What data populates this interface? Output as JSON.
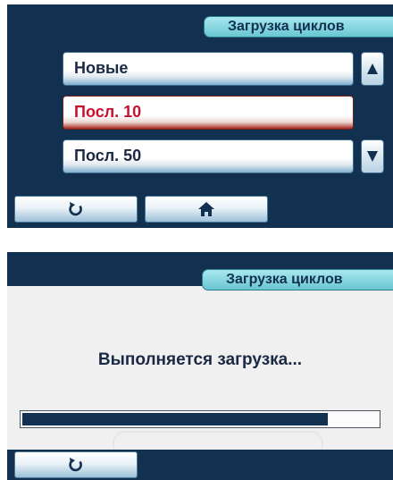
{
  "screen1": {
    "title": "Загрузка циклов",
    "items": [
      {
        "label": "Новые",
        "selected": false
      },
      {
        "label": "Посл. 10",
        "selected": true
      },
      {
        "label": "Посл. 50",
        "selected": false
      }
    ],
    "scroll_up_icon": "triangle-up-icon",
    "scroll_down_icon": "triangle-down-icon",
    "nav": [
      {
        "icon": "back-arrow-icon"
      },
      {
        "icon": "home-icon"
      }
    ],
    "colors": {
      "bar": "#12304f",
      "title_tab": "#7ccfd9",
      "selected_text": "#c8102e"
    }
  },
  "screen2": {
    "title": "Загрузка циклов",
    "message": "Выполняется загрузка...",
    "progress": 0.86,
    "nav": [
      {
        "icon": "back-arrow-icon"
      }
    ]
  }
}
